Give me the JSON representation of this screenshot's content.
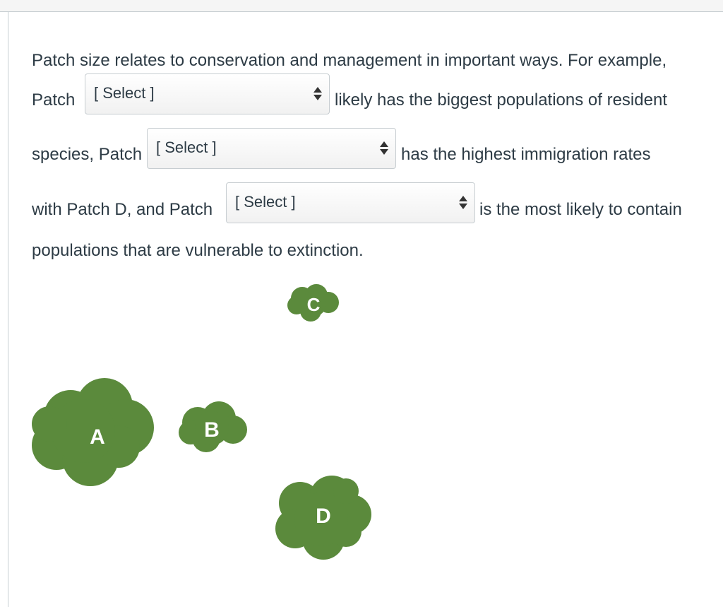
{
  "question": {
    "line1": "Patch size relates to conservation and management in important ways. For example,",
    "line2_prefix": "Patch",
    "line2_suffix": "likely has the biggest populations of resident",
    "line3_prefix": "species, Patch",
    "line3_suffix": "has the highest immigration rates",
    "line4_prefix": "with Patch D, and Patch",
    "line4_suffix": "is the most likely to contain",
    "line5": "populations that are vulnerable to extinction."
  },
  "dropdowns": [
    {
      "selected": "[ Select ]"
    },
    {
      "selected": "[ Select ]"
    },
    {
      "selected": "[ Select ]"
    }
  ],
  "figure": {
    "patch_color": "#5b8a3c",
    "patches": [
      {
        "label": "A"
      },
      {
        "label": "B"
      },
      {
        "label": "C"
      },
      {
        "label": "D"
      }
    ]
  }
}
